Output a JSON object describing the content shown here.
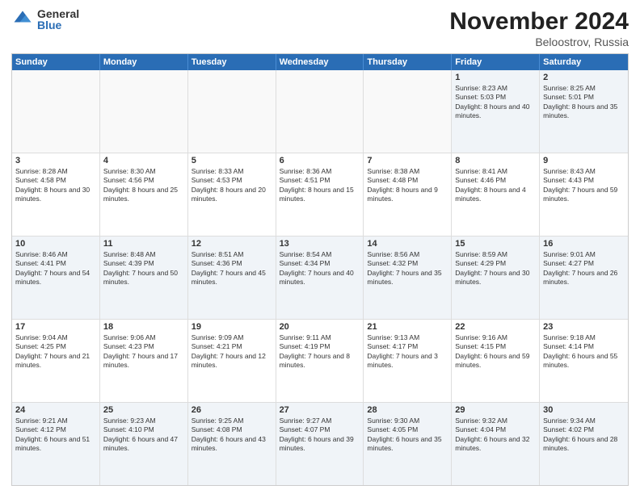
{
  "logo": {
    "general": "General",
    "blue": "Blue"
  },
  "title": "November 2024",
  "location": "Beloostrov, Russia",
  "header_days": [
    "Sunday",
    "Monday",
    "Tuesday",
    "Wednesday",
    "Thursday",
    "Friday",
    "Saturday"
  ],
  "rows": [
    [
      {
        "day": "",
        "text": "",
        "empty": true
      },
      {
        "day": "",
        "text": "",
        "empty": true
      },
      {
        "day": "",
        "text": "",
        "empty": true
      },
      {
        "day": "",
        "text": "",
        "empty": true
      },
      {
        "day": "",
        "text": "",
        "empty": true
      },
      {
        "day": "1",
        "text": "Sunrise: 8:23 AM\nSunset: 5:03 PM\nDaylight: 8 hours and 40 minutes.",
        "empty": false
      },
      {
        "day": "2",
        "text": "Sunrise: 8:25 AM\nSunset: 5:01 PM\nDaylight: 8 hours and 35 minutes.",
        "empty": false
      }
    ],
    [
      {
        "day": "3",
        "text": "Sunrise: 8:28 AM\nSunset: 4:58 PM\nDaylight: 8 hours and 30 minutes.",
        "empty": false
      },
      {
        "day": "4",
        "text": "Sunrise: 8:30 AM\nSunset: 4:56 PM\nDaylight: 8 hours and 25 minutes.",
        "empty": false
      },
      {
        "day": "5",
        "text": "Sunrise: 8:33 AM\nSunset: 4:53 PM\nDaylight: 8 hours and 20 minutes.",
        "empty": false
      },
      {
        "day": "6",
        "text": "Sunrise: 8:36 AM\nSunset: 4:51 PM\nDaylight: 8 hours and 15 minutes.",
        "empty": false
      },
      {
        "day": "7",
        "text": "Sunrise: 8:38 AM\nSunset: 4:48 PM\nDaylight: 8 hours and 9 minutes.",
        "empty": false
      },
      {
        "day": "8",
        "text": "Sunrise: 8:41 AM\nSunset: 4:46 PM\nDaylight: 8 hours and 4 minutes.",
        "empty": false
      },
      {
        "day": "9",
        "text": "Sunrise: 8:43 AM\nSunset: 4:43 PM\nDaylight: 7 hours and 59 minutes.",
        "empty": false
      }
    ],
    [
      {
        "day": "10",
        "text": "Sunrise: 8:46 AM\nSunset: 4:41 PM\nDaylight: 7 hours and 54 minutes.",
        "empty": false
      },
      {
        "day": "11",
        "text": "Sunrise: 8:48 AM\nSunset: 4:39 PM\nDaylight: 7 hours and 50 minutes.",
        "empty": false
      },
      {
        "day": "12",
        "text": "Sunrise: 8:51 AM\nSunset: 4:36 PM\nDaylight: 7 hours and 45 minutes.",
        "empty": false
      },
      {
        "day": "13",
        "text": "Sunrise: 8:54 AM\nSunset: 4:34 PM\nDaylight: 7 hours and 40 minutes.",
        "empty": false
      },
      {
        "day": "14",
        "text": "Sunrise: 8:56 AM\nSunset: 4:32 PM\nDaylight: 7 hours and 35 minutes.",
        "empty": false
      },
      {
        "day": "15",
        "text": "Sunrise: 8:59 AM\nSunset: 4:29 PM\nDaylight: 7 hours and 30 minutes.",
        "empty": false
      },
      {
        "day": "16",
        "text": "Sunrise: 9:01 AM\nSunset: 4:27 PM\nDaylight: 7 hours and 26 minutes.",
        "empty": false
      }
    ],
    [
      {
        "day": "17",
        "text": "Sunrise: 9:04 AM\nSunset: 4:25 PM\nDaylight: 7 hours and 21 minutes.",
        "empty": false
      },
      {
        "day": "18",
        "text": "Sunrise: 9:06 AM\nSunset: 4:23 PM\nDaylight: 7 hours and 17 minutes.",
        "empty": false
      },
      {
        "day": "19",
        "text": "Sunrise: 9:09 AM\nSunset: 4:21 PM\nDaylight: 7 hours and 12 minutes.",
        "empty": false
      },
      {
        "day": "20",
        "text": "Sunrise: 9:11 AM\nSunset: 4:19 PM\nDaylight: 7 hours and 8 minutes.",
        "empty": false
      },
      {
        "day": "21",
        "text": "Sunrise: 9:13 AM\nSunset: 4:17 PM\nDaylight: 7 hours and 3 minutes.",
        "empty": false
      },
      {
        "day": "22",
        "text": "Sunrise: 9:16 AM\nSunset: 4:15 PM\nDaylight: 6 hours and 59 minutes.",
        "empty": false
      },
      {
        "day": "23",
        "text": "Sunrise: 9:18 AM\nSunset: 4:14 PM\nDaylight: 6 hours and 55 minutes.",
        "empty": false
      }
    ],
    [
      {
        "day": "24",
        "text": "Sunrise: 9:21 AM\nSunset: 4:12 PM\nDaylight: 6 hours and 51 minutes.",
        "empty": false
      },
      {
        "day": "25",
        "text": "Sunrise: 9:23 AM\nSunset: 4:10 PM\nDaylight: 6 hours and 47 minutes.",
        "empty": false
      },
      {
        "day": "26",
        "text": "Sunrise: 9:25 AM\nSunset: 4:08 PM\nDaylight: 6 hours and 43 minutes.",
        "empty": false
      },
      {
        "day": "27",
        "text": "Sunrise: 9:27 AM\nSunset: 4:07 PM\nDaylight: 6 hours and 39 minutes.",
        "empty": false
      },
      {
        "day": "28",
        "text": "Sunrise: 9:30 AM\nSunset: 4:05 PM\nDaylight: 6 hours and 35 minutes.",
        "empty": false
      },
      {
        "day": "29",
        "text": "Sunrise: 9:32 AM\nSunset: 4:04 PM\nDaylight: 6 hours and 32 minutes.",
        "empty": false
      },
      {
        "day": "30",
        "text": "Sunrise: 9:34 AM\nSunset: 4:02 PM\nDaylight: 6 hours and 28 minutes.",
        "empty": false
      }
    ]
  ],
  "colors": {
    "header_bg": "#2a6db5",
    "alt_row_bg": "#eef2f7",
    "border": "#ccc"
  }
}
